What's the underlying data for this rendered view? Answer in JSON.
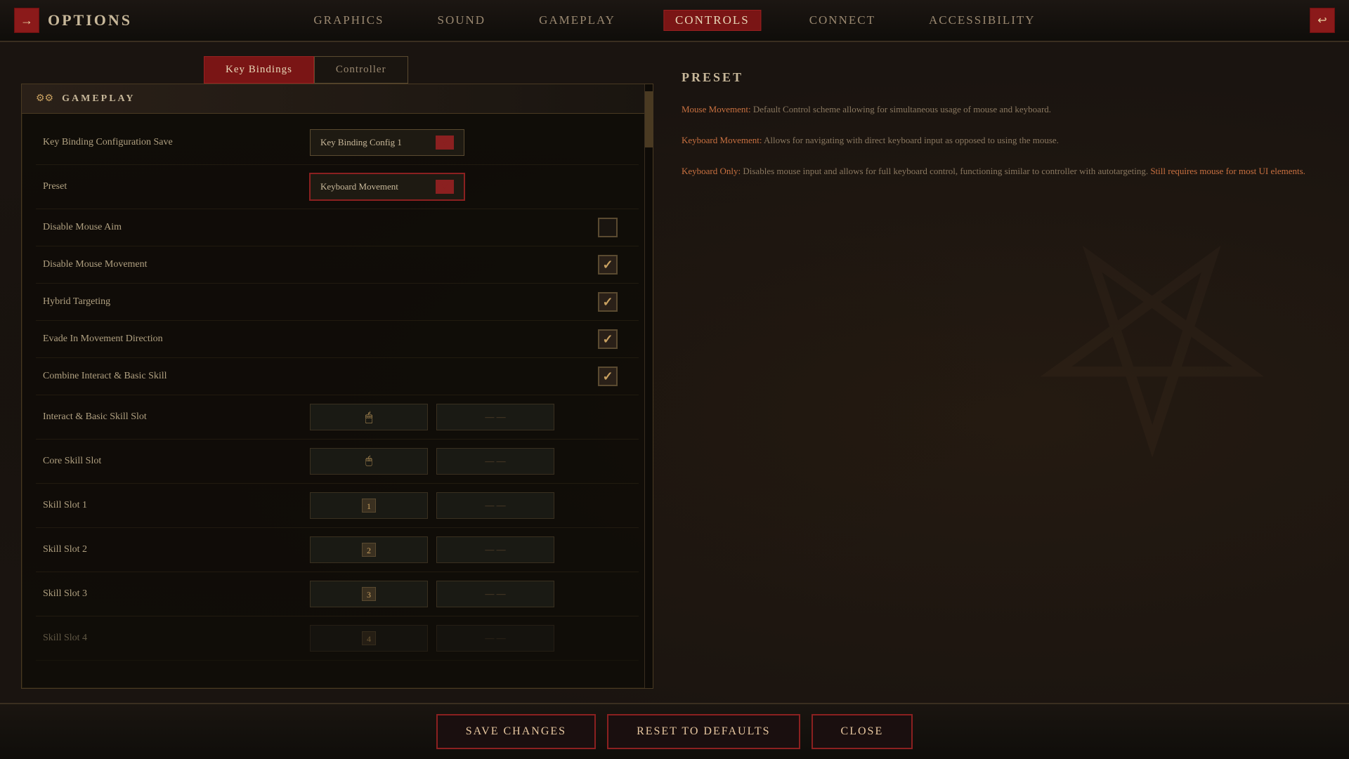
{
  "nav": {
    "back_label": "→",
    "options_label": "OPTIONS",
    "items": [
      {
        "id": "graphics",
        "label": "GRAPHICS",
        "active": false
      },
      {
        "id": "sound",
        "label": "SOUND",
        "active": false
      },
      {
        "id": "gameplay",
        "label": "GAMEPLAY",
        "active": false
      },
      {
        "id": "controls",
        "label": "CONTROLS",
        "active": true
      },
      {
        "id": "connect",
        "label": "CONNECT",
        "active": false
      },
      {
        "id": "accessibility",
        "label": "ACCESSIBILITY",
        "active": false
      }
    ]
  },
  "tabs": [
    {
      "id": "key-bindings",
      "label": "Key Bindings",
      "active": true
    },
    {
      "id": "controller",
      "label": "Controller",
      "active": false
    }
  ],
  "section": {
    "icon": "⚙",
    "title": "GAMEPLAY"
  },
  "settings": [
    {
      "id": "key-binding-config",
      "label": "Key Binding Configuration Save",
      "type": "dropdown",
      "value": "Key Binding Config 1",
      "highlighted": false
    },
    {
      "id": "preset",
      "label": "Preset",
      "type": "dropdown",
      "value": "Keyboard Movement",
      "highlighted": true
    },
    {
      "id": "disable-mouse-aim",
      "label": "Disable Mouse Aim",
      "type": "checkbox",
      "checked": false
    },
    {
      "id": "disable-mouse-movement",
      "label": "Disable Mouse Movement",
      "type": "checkbox",
      "checked": true
    },
    {
      "id": "hybrid-targeting",
      "label": "Hybrid Targeting",
      "type": "checkbox",
      "checked": true
    },
    {
      "id": "evade-movement-direction",
      "label": "Evade In Movement Direction",
      "type": "checkbox",
      "checked": true
    },
    {
      "id": "combine-interact",
      "label": "Combine Interact & Basic Skill",
      "type": "checkbox",
      "checked": true
    },
    {
      "id": "interact-basic-slot",
      "label": "Interact & Basic Skill Slot",
      "type": "keybind",
      "primary": "mouse_icon",
      "secondary": "dash_icon"
    },
    {
      "id": "core-skill-slot",
      "label": "Core Skill Slot",
      "type": "keybind",
      "primary": "mouse_icon2",
      "secondary": "dash_icon2"
    },
    {
      "id": "skill-slot-1",
      "label": "Skill Slot 1",
      "type": "keybind",
      "primary": "1",
      "secondary": "dash_icon3"
    },
    {
      "id": "skill-slot-2",
      "label": "Skill Slot 2",
      "type": "keybind",
      "primary": "2",
      "secondary": "dash_icon4"
    },
    {
      "id": "skill-slot-3",
      "label": "Skill Slot 3",
      "type": "keybind",
      "primary": "3",
      "secondary": "dash_icon5"
    },
    {
      "id": "skill-slot-4",
      "label": "Skill Slot 4",
      "type": "keybind",
      "primary": "4",
      "secondary": "dash_icon6"
    }
  ],
  "preset_info": {
    "title": "PRESET",
    "description_parts": [
      {
        "type": "term",
        "text": "Mouse Movement:"
      },
      {
        "type": "normal",
        "text": " Default Control scheme allowing for simultaneous usage of mouse and keyboard."
      },
      {
        "type": "linebreak"
      },
      {
        "type": "term",
        "text": "Keyboard Movement:"
      },
      {
        "type": "normal",
        "text": " Allows for navigating with direct keyboard input as opposed to using the mouse."
      },
      {
        "type": "linebreak"
      },
      {
        "type": "term",
        "text": "Keyboard Only:"
      },
      {
        "type": "normal",
        "text": " Disables mouse input and allows for full keyboard control, functioning similar to controller with autotargeting. "
      },
      {
        "type": "link",
        "text": "Still requires mouse for most UI elements."
      }
    ]
  },
  "buttons": {
    "save": "Save Changes",
    "reset": "Reset to Defaults",
    "close": "Close"
  }
}
